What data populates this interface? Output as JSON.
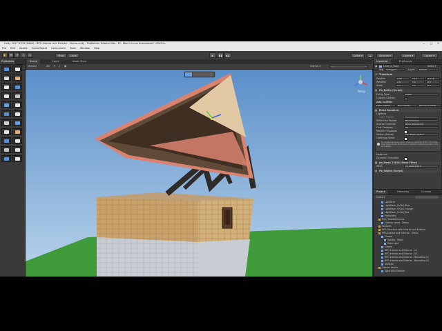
{
  "window": {
    "title": "Unity 2017.3.0f3 (64bit) - RPG Interior and Exterior - Demo.unity - ProBuilder Tutorial Vids - PC, Mac & Linux Standalone* <DX11>",
    "controls": [
      "—",
      "□",
      "✕"
    ]
  },
  "menu": [
    "File",
    "Edit",
    "Assets",
    "GameObject",
    "Component",
    "Tools",
    "Window",
    "Help"
  ],
  "toolbar": {
    "pivot": "Pivot",
    "local": "Local",
    "collab": "Collab ▾",
    "account": "Account ▾",
    "layers": "Layers ▾",
    "layout": "Layout ▾"
  },
  "probuilder": {
    "tab": "ProBuilder"
  },
  "scene": {
    "tabs": [
      "Scene",
      "Game",
      "Asset Store"
    ],
    "shaded": "Shaded",
    "mode": "2D",
    "gizmos": "Gizmos ▾",
    "search_placeholder": "All",
    "persp": "Persp"
  },
  "inspector": {
    "tabs": [
      "Inspector",
      "ProGroups"
    ],
    "layer_label": "Layer",
    "layer_value": "Level_2_Roof",
    "static": "Static ▾",
    "tag_label": "Tag",
    "tag_value": "Untagged",
    "layer2_label": "Layer",
    "layer2_value": "Default",
    "transform": "Transform",
    "position": {
      "label": "Position",
      "x": "X 36",
      "y": "Y 13",
      "z": "Z 2.11"
    },
    "rotation": {
      "label": "Rotation",
      "x": "X 0",
      "y": "Y 0",
      "z": "Z 0"
    },
    "scale": {
      "label": "Scale",
      "x": "X 1",
      "y": "Y 1",
      "z": "Z 1"
    },
    "entity": {
      "title": "Pb_Entity (Script)",
      "entity_type_label": "Entity Type",
      "entity_type_value": "Detail",
      "custom_collider": "Custom Collider",
      "add_collider": "Add Collider",
      "collider_buttons": [
        "Mesh Collider",
        "Box Collider",
        "Remove Collider"
      ]
    },
    "mesh_renderer": {
      "title": "Mesh Renderer",
      "lighting": "Lighting",
      "light_probes_label": "Light Probes",
      "light_probes_value": "Blend Probes",
      "reflection_probes_label": "Reflection Probes",
      "reflection_probes_value": "Blend Probes",
      "anchor_label": "Anchor Override",
      "anchor_value": "None (Transform)",
      "cast_shadows_label": "Cast Shadows",
      "cast_shadows_value": "On",
      "receive_shadows_label": "Receive Shadows",
      "motion_vectors_label": "Motion Vectors",
      "motion_vectors_value": "Per Object Motion",
      "lightmap_static_label": "Lightmap Static",
      "info": "To visualize lightmaps set the object as Lightmap Static in the Static flags. Baked Global Illumination or Realtime Global Illumination must be enabled.",
      "materials": "Materials",
      "dynamic_occluded": "Dynamic Occluded"
    },
    "mesh_filter": {
      "title": "pb_Mesh 23610 (Mesh Filter)",
      "mesh_label": "Mesh",
      "mesh_value": "pb_Mesh23610"
    },
    "object": {
      "title": "Pb_Object (Script)"
    }
  },
  "project": {
    "tabs": [
      "Project",
      "Hierarchy",
      "Console"
    ],
    "create": "Create ▾",
    "items": [
      {
        "label": "LightGrid",
        "indent": 2
      },
      {
        "label": "LightMesh_OnTall_Blue",
        "indent": 2
      },
      {
        "label": "LightMesh_OnTall_Orange",
        "indent": 2
      },
      {
        "label": "LightMesh_OnTall_Red",
        "indent": 2
      },
      {
        "label": "ProBuilder",
        "indent": 2
      },
      {
        "label": "Prim Tutorial Scenes",
        "indent": 1
      },
      {
        "label": "Exterior Level - Demo",
        "indent": 2
      },
      {
        "label": "Features",
        "indent": 1
      },
      {
        "label": "RPG Structure with Interior and Exterior",
        "indent": 1
      },
      {
        "label": "RPG Interior and Exterior - Demo",
        "indent": 1
      },
      {
        "label": "Candle",
        "indent": 2
      },
      {
        "label": "Candle - Mesh",
        "indent": 3
      },
      {
        "label": "Point light",
        "indent": 3
      },
      {
        "label": "Candle",
        "indent": 2
      },
      {
        "label": "RPG Interior and Exterior - 02",
        "indent": 2
      },
      {
        "label": "RPG Interior and Exterior - 03",
        "indent": 2
      },
      {
        "label": "RPG Interior and Exterior - Recording 01",
        "indent": 2
      },
      {
        "label": "RPG Interior and Exterior - Recording 02",
        "indent": 2
      },
      {
        "label": "Shadow",
        "indent": 2
      },
      {
        "label": "Tutorial Assets",
        "indent": 1
      },
      {
        "label": "SketchGridTexture",
        "indent": 2
      }
    ]
  },
  "colors": {
    "sky_top": "#5a8fc9",
    "sky_bottom": "#b9d3eb",
    "ground": "#3f9b3a",
    "wall": "#c8a26a",
    "wall_lower": "#c7cdd3",
    "roof_edge": "#d9836e",
    "beam": "#2f2b28"
  }
}
